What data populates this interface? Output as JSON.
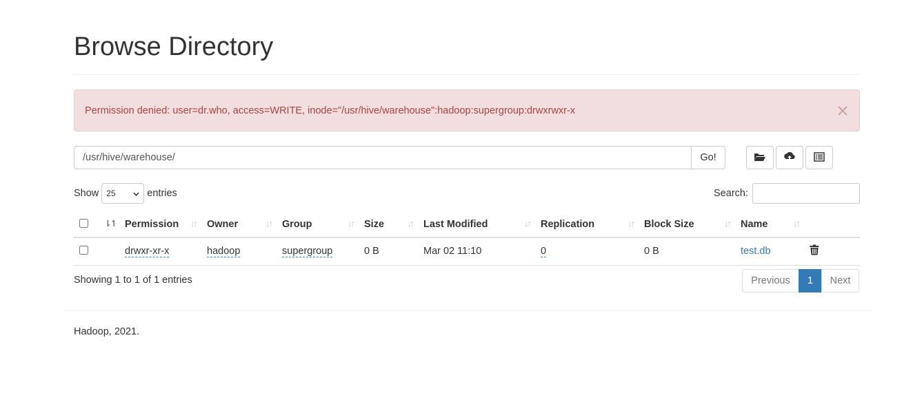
{
  "header": {
    "title": "Browse Directory"
  },
  "alert": {
    "message": "Permission denied: user=dr.who, access=WRITE, inode=\"/usr/hive/warehouse\":hadoop:supergroup:drwxrwxr-x",
    "close_icon": "close-icon"
  },
  "path": {
    "value": "/usr/hive/warehouse/",
    "go_label": "Go!"
  },
  "toolbar": {
    "icons": [
      "folder-open-icon",
      "cloud-upload-icon",
      "list-alt-icon"
    ]
  },
  "length": {
    "show_label": "Show",
    "selected": "25",
    "entries_label": "entries"
  },
  "search": {
    "label": "Search:",
    "value": ""
  },
  "table": {
    "columns": [
      "Permission",
      "Owner",
      "Group",
      "Size",
      "Last Modified",
      "Replication",
      "Block Size",
      "Name"
    ],
    "rows": [
      {
        "permission": "drwxr-xr-x",
        "owner": "hadoop",
        "group": "supergroup",
        "size": "0 B",
        "last_modified": "Mar 02 11:10",
        "replication": "0",
        "block_size": "0 B",
        "name": "test.db"
      }
    ]
  },
  "info": "Showing 1 to 1 of 1 entries",
  "pagination": {
    "previous": "Previous",
    "current": "1",
    "next": "Next"
  },
  "footer": {
    "text": "Hadoop, 2021."
  },
  "colors": {
    "link": "#337ab7",
    "alert_bg": "#f2dede",
    "alert_text": "#a94442"
  }
}
